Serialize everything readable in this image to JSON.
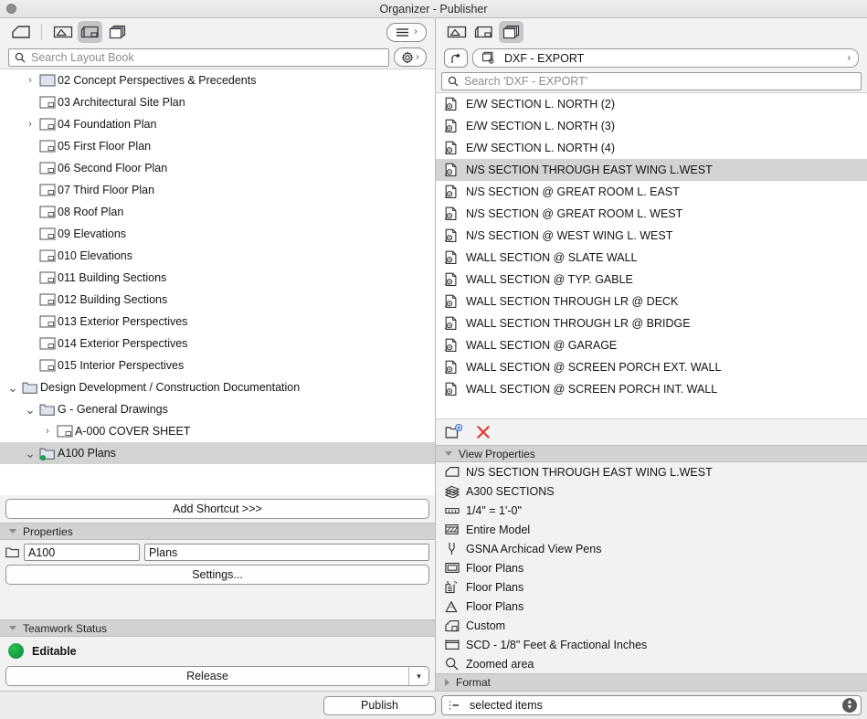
{
  "window": {
    "title": "Organizer - Publisher"
  },
  "left": {
    "toolbar": {
      "home_icon": "home-project-icon",
      "views_icon": "view-map-icon",
      "layout_icon": "layout-book-icon",
      "publisher_icon": "publisher-sets-icon",
      "menu_button_label": "",
      "menu_icon": "hamburger-menu-icon"
    },
    "search": {
      "placeholder": "Search Layout Book",
      "icon": "search-icon",
      "gear_icon": "gear-icon"
    },
    "tree": [
      {
        "label": "02 Concept Perspectives & Precedents",
        "indent": 1,
        "twisty": "right",
        "icon": "layout-icon",
        "selected": false,
        "partial": true
      },
      {
        "label": "03 Architectural Site Plan",
        "indent": 1,
        "twisty": "none",
        "icon": "layout-icon",
        "selected": false
      },
      {
        "label": "04 Foundation Plan",
        "indent": 1,
        "twisty": "right",
        "icon": "layout-icon",
        "selected": false
      },
      {
        "label": "05 First Floor Plan",
        "indent": 1,
        "twisty": "none",
        "icon": "layout-icon",
        "selected": false
      },
      {
        "label": "06 Second Floor Plan",
        "indent": 1,
        "twisty": "none",
        "icon": "layout-icon",
        "selected": false
      },
      {
        "label": "07 Third Floor Plan",
        "indent": 1,
        "twisty": "none",
        "icon": "layout-icon",
        "selected": false
      },
      {
        "label": "08 Roof Plan",
        "indent": 1,
        "twisty": "none",
        "icon": "layout-icon",
        "selected": false
      },
      {
        "label": "09 Elevations",
        "indent": 1,
        "twisty": "none",
        "icon": "layout-icon",
        "selected": false
      },
      {
        "label": "010 Elevations",
        "indent": 1,
        "twisty": "none",
        "icon": "layout-icon",
        "selected": false
      },
      {
        "label": "011 Building Sections",
        "indent": 1,
        "twisty": "none",
        "icon": "layout-icon",
        "selected": false
      },
      {
        "label": "012 Building Sections",
        "indent": 1,
        "twisty": "none",
        "icon": "layout-icon",
        "selected": false
      },
      {
        "label": "013 Exterior Perspectives",
        "indent": 1,
        "twisty": "none",
        "icon": "layout-icon",
        "selected": false
      },
      {
        "label": "014 Exterior Perspectives",
        "indent": 1,
        "twisty": "none",
        "icon": "layout-icon",
        "selected": false
      },
      {
        "label": "015 Interior Perspectives",
        "indent": 1,
        "twisty": "none",
        "icon": "layout-icon",
        "selected": false
      },
      {
        "label": "Design Development / Construction Documentation",
        "indent": 0,
        "twisty": "down",
        "icon": "folder-icon",
        "selected": false
      },
      {
        "label": "G - General Drawings",
        "indent": 1,
        "twisty": "down",
        "icon": "folder-icon",
        "selected": false
      },
      {
        "label": "A-000 COVER SHEET",
        "indent": 2,
        "twisty": "right",
        "icon": "layout-icon",
        "selected": false
      },
      {
        "label": "A100 Plans",
        "indent": 1,
        "twisty": "down",
        "icon": "folder-green-icon",
        "selected": true
      }
    ],
    "add_shortcut_label": "Add Shortcut >>>",
    "properties": {
      "header": "Properties",
      "folder_icon": "folder-icon",
      "id_value": "A100",
      "name_value": "Plans",
      "settings_label": "Settings..."
    },
    "teamwork": {
      "header": "Teamwork Status",
      "status_label": "Editable",
      "status_color": "#0d9c3e",
      "release_label": "Release"
    }
  },
  "right": {
    "toolbar": {
      "views_icon": "view-map-icon",
      "layout_icon": "layout-book-icon",
      "publisher_icon": "publisher-sets-icon"
    },
    "set_bar": {
      "up_icon": "go-up-icon",
      "set_icon": "publisher-set-icon",
      "set_name": "DXF - EXPORT",
      "chevron": "chevron-right-icon"
    },
    "search": {
      "placeholder": "Search 'DXF - EXPORT'",
      "icon": "search-icon"
    },
    "items": [
      {
        "label": "E/W SECTION  L. NORTH (2)",
        "selected": false
      },
      {
        "label": "E/W SECTION L. NORTH  (3)",
        "selected": false
      },
      {
        "label": "E/W SECTION L. NORTH (4)",
        "selected": false
      },
      {
        "label": "N/S SECTION THROUGH EAST WING  L.WEST",
        "selected": true
      },
      {
        "label": "N/S SECTION @ GREAT ROOM  L. EAST",
        "selected": false
      },
      {
        "label": "N/S SECTION @ GREAT ROOM L. WEST",
        "selected": false
      },
      {
        "label": "N/S SECTION @ WEST WING L. WEST",
        "selected": false
      },
      {
        "label": "WALL SECTION @ SLATE WALL",
        "selected": false
      },
      {
        "label": "WALL SECTION @ TYP. GABLE",
        "selected": false
      },
      {
        "label": "WALL SECTION THROUGH LR @ DECK",
        "selected": false
      },
      {
        "label": "WALL SECTION  THROUGH LR @ BRIDGE",
        "selected": false
      },
      {
        "label": "WALL SECTION @ GARAGE",
        "selected": false
      },
      {
        "label": "WALL SECTION @ SCREEN PORCH EXT. WALL",
        "selected": false
      },
      {
        "label": "WALL SECTION @ SCREEN PORCH INT. WALL",
        "selected": false
      }
    ],
    "actions": {
      "new_folder_icon": "new-folder-icon",
      "delete_icon": "delete-x-icon"
    },
    "view_properties": {
      "header": "View Properties",
      "rows": [
        {
          "icon": "section-view-icon",
          "label": "N/S SECTION THROUGH EAST WING  L.WEST"
        },
        {
          "icon": "layers-icon",
          "label": "A300 SECTIONS"
        },
        {
          "icon": "scale-icon",
          "label": "1/4\"   =    1'-0\""
        },
        {
          "icon": "partial-structure-icon",
          "label": "Entire Model"
        },
        {
          "icon": "pen-set-icon",
          "label": "GSNA Archicad View Pens"
        },
        {
          "icon": "model-view-options-icon",
          "label": "Floor Plans"
        },
        {
          "icon": "renovation-filter-icon",
          "label": "Floor Plans"
        },
        {
          "icon": "graphic-override-icon",
          "label": "Floor Plans"
        },
        {
          "icon": "3d-style-icon",
          "label": "Custom"
        },
        {
          "icon": "dimension-icon",
          "label": "SCD - 1/8\" Feet & Fractional Inches"
        },
        {
          "icon": "zoom-icon",
          "label": "Zoomed area"
        }
      ],
      "format_header": "Format"
    }
  },
  "bottom": {
    "publish_label": "Publish",
    "scope_icon": "selected-items-icon",
    "scope_value": "selected items",
    "stepper_icon": "stepper-updown-icon"
  }
}
